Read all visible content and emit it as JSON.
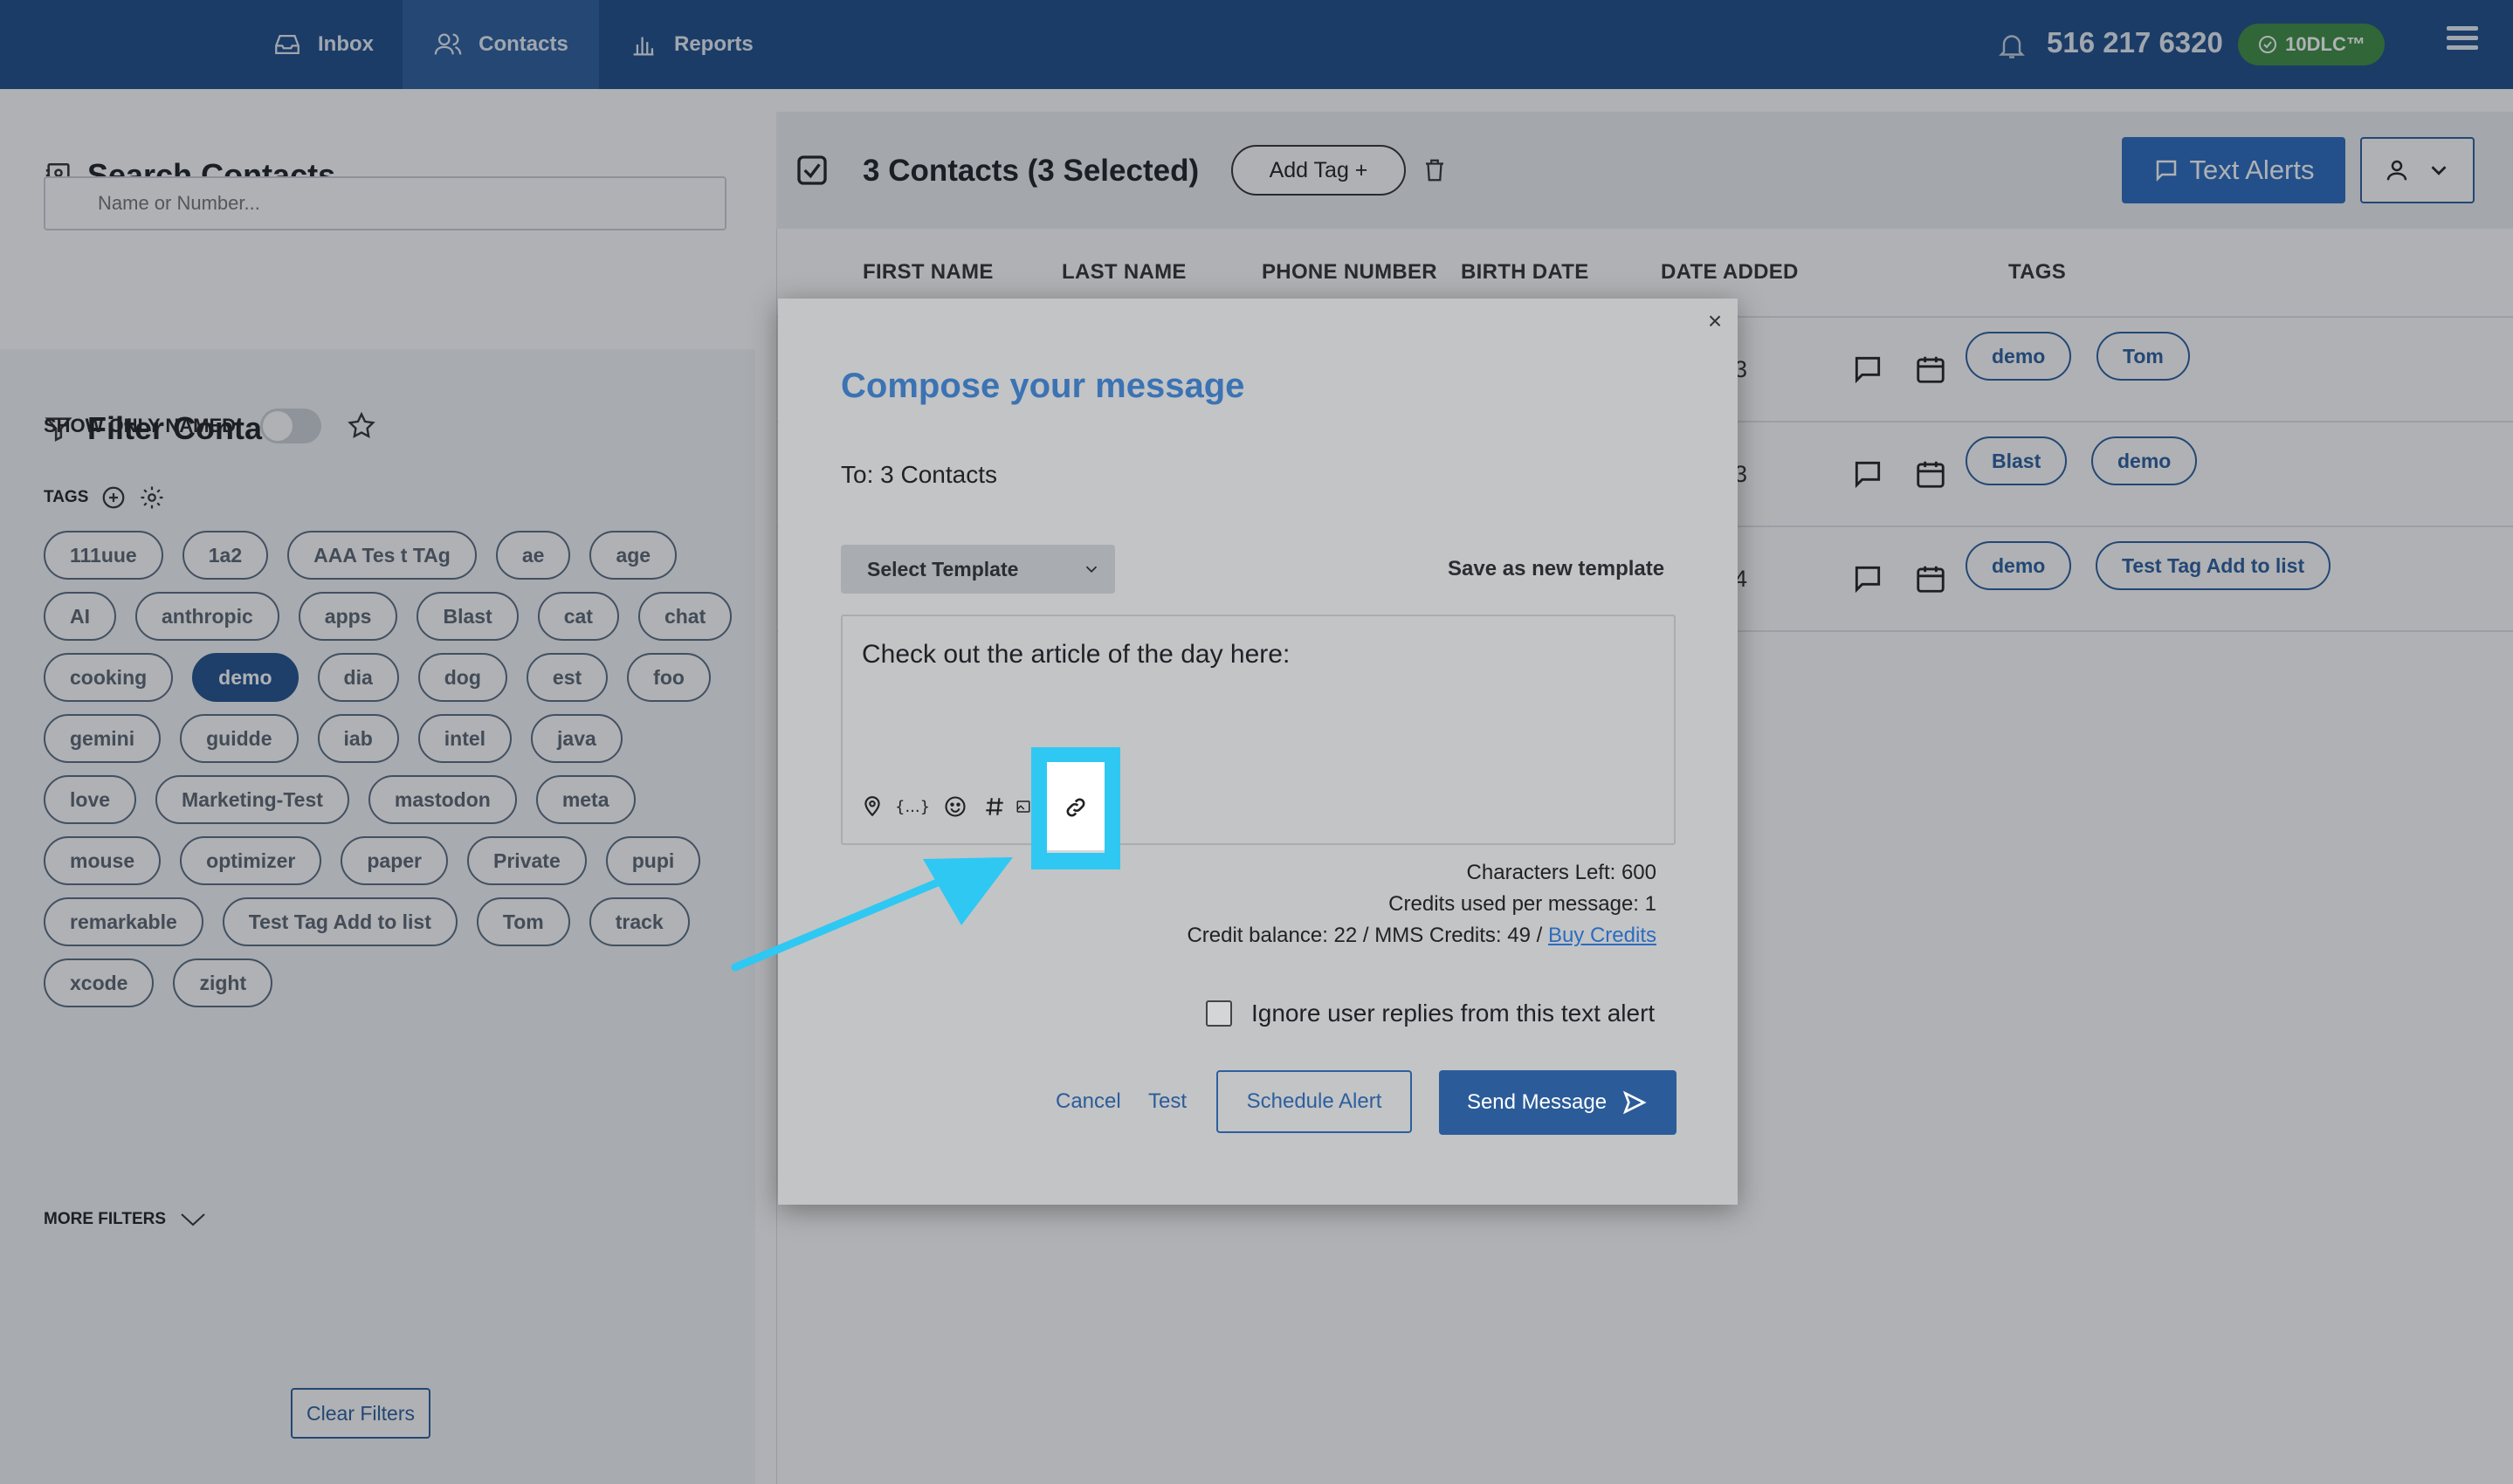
{
  "nav": {
    "inbox": "Inbox",
    "contacts": "Contacts",
    "reports": "Reports",
    "phone": "516 217 6320",
    "badge": "10DLC™"
  },
  "sidebar": {
    "search_title": "Search Contacts",
    "search_placeholder": "Name or Number...",
    "filter_title": "Filter Contacts",
    "show_only_named": "SHOW ONLY NAMED",
    "tags_label": "TAGS",
    "tags": [
      "111uue",
      "1a2",
      "AAA Tes t TAg",
      "ae",
      "age",
      "AI",
      "anthropic",
      "apps",
      "Blast",
      "cat",
      "chat",
      "cooking",
      "demo",
      "dia",
      "dog",
      "est",
      "foo",
      "gemini",
      "guidde",
      "iab",
      "intel",
      "java",
      "love",
      "Marketing-Test",
      "mastodon",
      "meta",
      "mouse",
      "optimizer",
      "paper",
      "Private",
      "pupi",
      "remarkable",
      "Test Tag Add to list",
      "Tom",
      "track",
      "xcode",
      "zight"
    ],
    "active_tag": "demo",
    "more_filters": "MORE FILTERS",
    "clear_filters": "Clear Filters"
  },
  "main": {
    "contacts_count": "3 Contacts (3 Selected)",
    "add_tag": "Add Tag +",
    "text_alerts": "Text Alerts",
    "columns": [
      "FIRST NAME",
      "LAST NAME",
      "PHONE NUMBER",
      "BIRTH DATE",
      "DATE ADDED",
      "TAGS"
    ],
    "rows": [
      {
        "date_fragment": "3",
        "tags": [
          "demo",
          "Tom"
        ]
      },
      {
        "date_fragment": "3",
        "tags": [
          "Blast",
          "demo"
        ]
      },
      {
        "date_fragment": "4",
        "tags": [
          "demo",
          "Test Tag Add to list"
        ]
      }
    ]
  },
  "modal": {
    "close": "×",
    "title": "Compose your message",
    "to": "To: 3 Contacts",
    "template_select": "Select Template",
    "save_template": "Save as new template",
    "message": "Check out the article of the day here:",
    "toolbar_icons": [
      "location-icon",
      "variables-icon",
      "emoji-icon",
      "hashtag-icon",
      "image-icon",
      "link-icon"
    ],
    "chars_left": "Characters Left: 600",
    "credits_per_message": "Credits used per message: 1",
    "credit_balance": "Credit balance: 22 / MMS Credits: 49 / ",
    "buy_credits": "Buy Credits",
    "ignore_replies": "Ignore user replies from this text alert",
    "cancel": "Cancel",
    "test": "Test",
    "schedule": "Schedule Alert",
    "send": "Send Message"
  },
  "colors": {
    "nav_bg": "#1f4e89",
    "accent": "#2b6cbf",
    "badge_green": "#3f8d44",
    "highlight": "#2ec8f3"
  }
}
